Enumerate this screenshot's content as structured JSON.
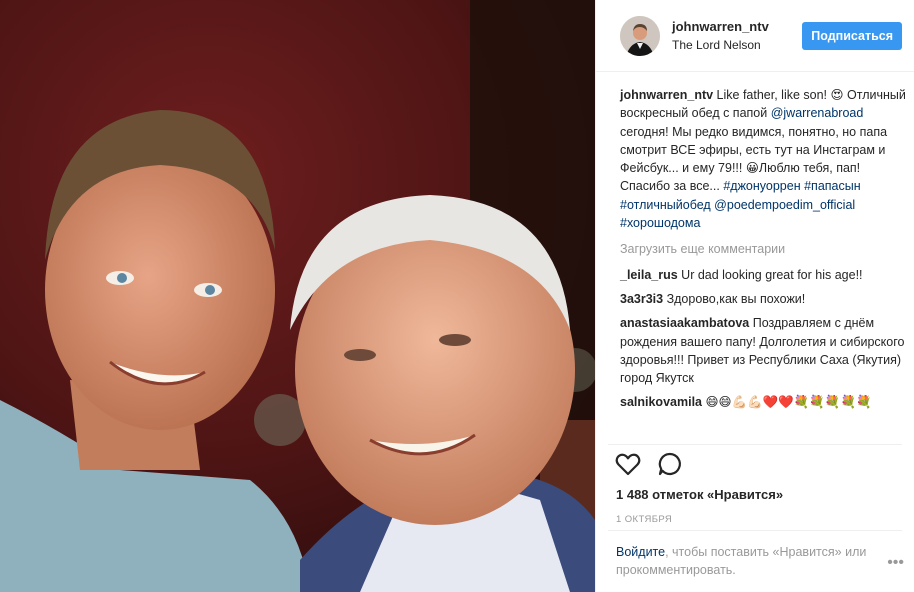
{
  "header": {
    "username": "johnwarren_ntv",
    "location": "The Lord Nelson",
    "follow_label": "Подписаться"
  },
  "caption": {
    "username": "johnwarren_ntv",
    "text_1": " Like father, like son! ",
    "emoji_1": "😍",
    "text_2": " Отличный воскресный обед с папой ",
    "mention_1": "@jwarrenabroad",
    "text_3": " сегодня! Мы редко видимся, понятно, но папа смотрит ВСЕ эфиры, есть тут на Инстаграм и Фейсбук... и ему 79!!! ",
    "emoji_2": "😀",
    "text_4": "Люблю тебя, пап! Спасибо за все... ",
    "hashtag_1": "#джонуоррен",
    "hashtag_2": "#папасын",
    "hashtag_3": "#отличныйобед",
    "mention_2": "@poedempoedim_official",
    "hashtag_4": "#хорошодома"
  },
  "load_more": "Загрузить еще комментарии",
  "comments": [
    {
      "username": "_leila_rus",
      "text": " Ur dad looking great for his age!!"
    },
    {
      "username": "3a3r3i3",
      "text": " Здорово,как вы похожи!"
    },
    {
      "username": "anastasiaakambatova",
      "text": " Поздравляем с днём рождения вашего папу! Долголетия и сибирского здоровья!!! Привет из Республики Саха (Якутия) город Якутск"
    },
    {
      "username": "salnikovamila",
      "text": " 😄😄💪🏻💪🏻❤️❤️💐💐💐💐💐"
    }
  ],
  "likes": "1 488 отметок «Нравится»",
  "date": "1 ОКТЯБРЯ",
  "login": {
    "link": "Войдите",
    "text": ", чтобы поставить «Нравится» или прокомментировать."
  },
  "icons": {
    "like": "heart-icon",
    "comment": "comment-bubble-icon",
    "more": "more-options-icon"
  },
  "colors": {
    "accent": "#3897f0",
    "link": "#003569",
    "muted": "#999999"
  }
}
